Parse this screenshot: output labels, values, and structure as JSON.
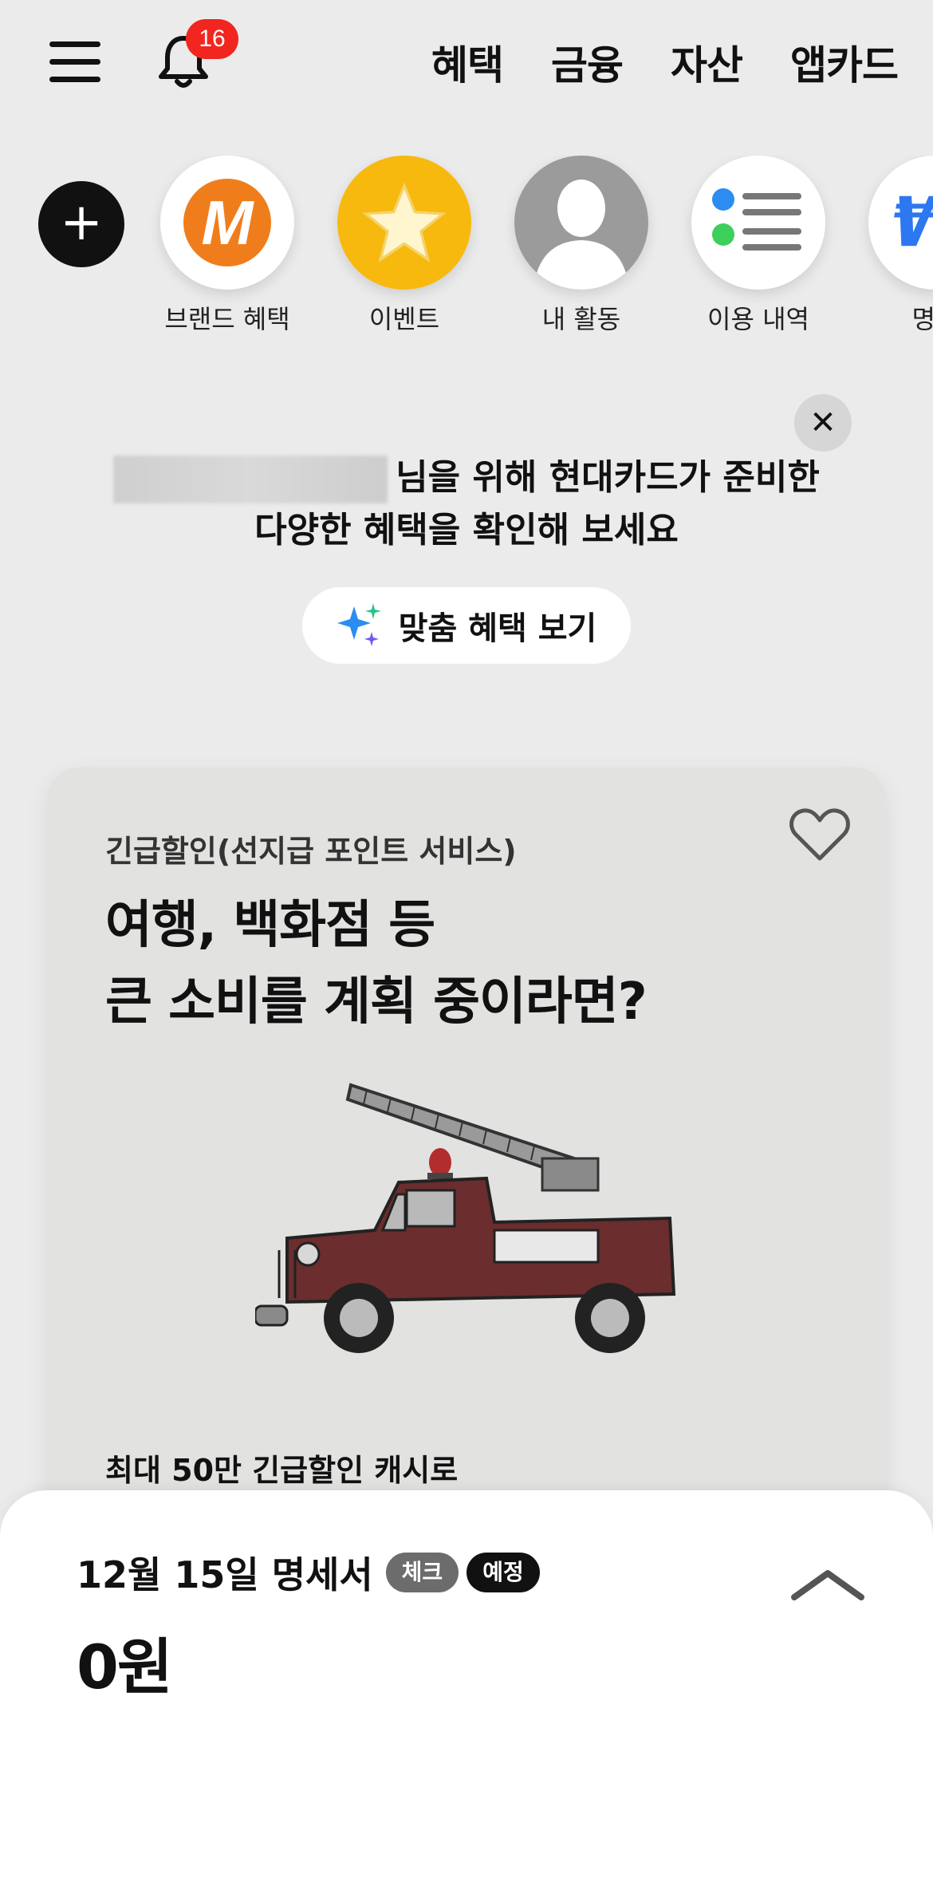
{
  "header": {
    "notification_count": "16",
    "nav": [
      "혜택",
      "금융",
      "자산",
      "앱카드"
    ]
  },
  "quick_menu": {
    "items": [
      {
        "label": "브랜드 혜택",
        "icon": "m-brand-icon"
      },
      {
        "label": "이벤트",
        "icon": "star-icon"
      },
      {
        "label": "내 활동",
        "icon": "profile-icon"
      },
      {
        "label": "이용 내역",
        "icon": "list-icon"
      },
      {
        "label": "명세",
        "icon": "won-icon"
      }
    ]
  },
  "greeting": {
    "line1_suffix": "님을 위해 현대카드가 준비한",
    "line2": "다양한 혜택을 확인해 보세요",
    "button_label": "맞춤 혜택 보기"
  },
  "promo_card": {
    "category": "긴급할인(선지급 포인트 서비스)",
    "title_line1": "여행, 백화점 등",
    "title_line2": "큰 소비를 계획 중이라면?",
    "footer": "최대 50만 긴급할인 캐시로"
  },
  "statement": {
    "title": "12월 15일 명세서",
    "tag_check": "체크",
    "tag_planned": "예정",
    "amount": "0원"
  },
  "colors": {
    "background": "#ebebeb",
    "badge": "#f0261f",
    "brand_orange": "#f07d1c",
    "star_yellow": "#f7b90e",
    "truck_body": "#6b2d2d"
  }
}
